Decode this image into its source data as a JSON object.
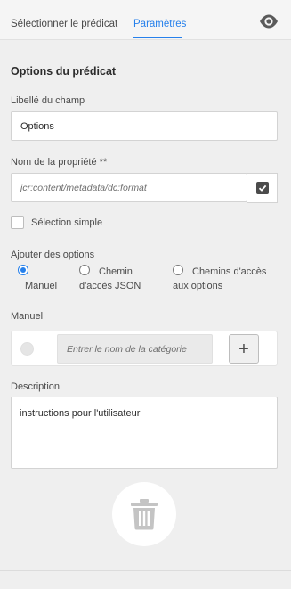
{
  "tabs": [
    {
      "label": "Sélectionner le prédicat",
      "active": false
    },
    {
      "label": "Paramètres",
      "active": true
    }
  ],
  "icons": {
    "preview": "eye-icon",
    "delete": "trash-icon",
    "checkbox_checked": "checkmark-icon"
  },
  "colors": {
    "accent": "#2680eb",
    "background": "#efefef"
  },
  "section_title": "Options du prédicat",
  "field_label": {
    "label": "Libellé du champ",
    "value": "Options"
  },
  "property_name": {
    "label": "Nom de la propriété **",
    "value": "jcr:content/metadata/dc:format",
    "checked": true
  },
  "simple_selection": {
    "label": "Sélection simple",
    "checked": false
  },
  "add_options": {
    "label": "Ajouter des options",
    "options": [
      {
        "line1": "Manuel",
        "line2": "",
        "selected": true
      },
      {
        "line1": "Chemin",
        "line2": "d'accès JSON",
        "selected": false
      },
      {
        "line1": "Chemins d'accès",
        "line2": "aux options",
        "selected": false
      }
    ]
  },
  "manual": {
    "label": "Manuel",
    "placeholder": "Entrer le nom de la catégorie",
    "add_label": "+"
  },
  "description": {
    "label": "Description",
    "value": "instructions pour l'utilisateur"
  }
}
